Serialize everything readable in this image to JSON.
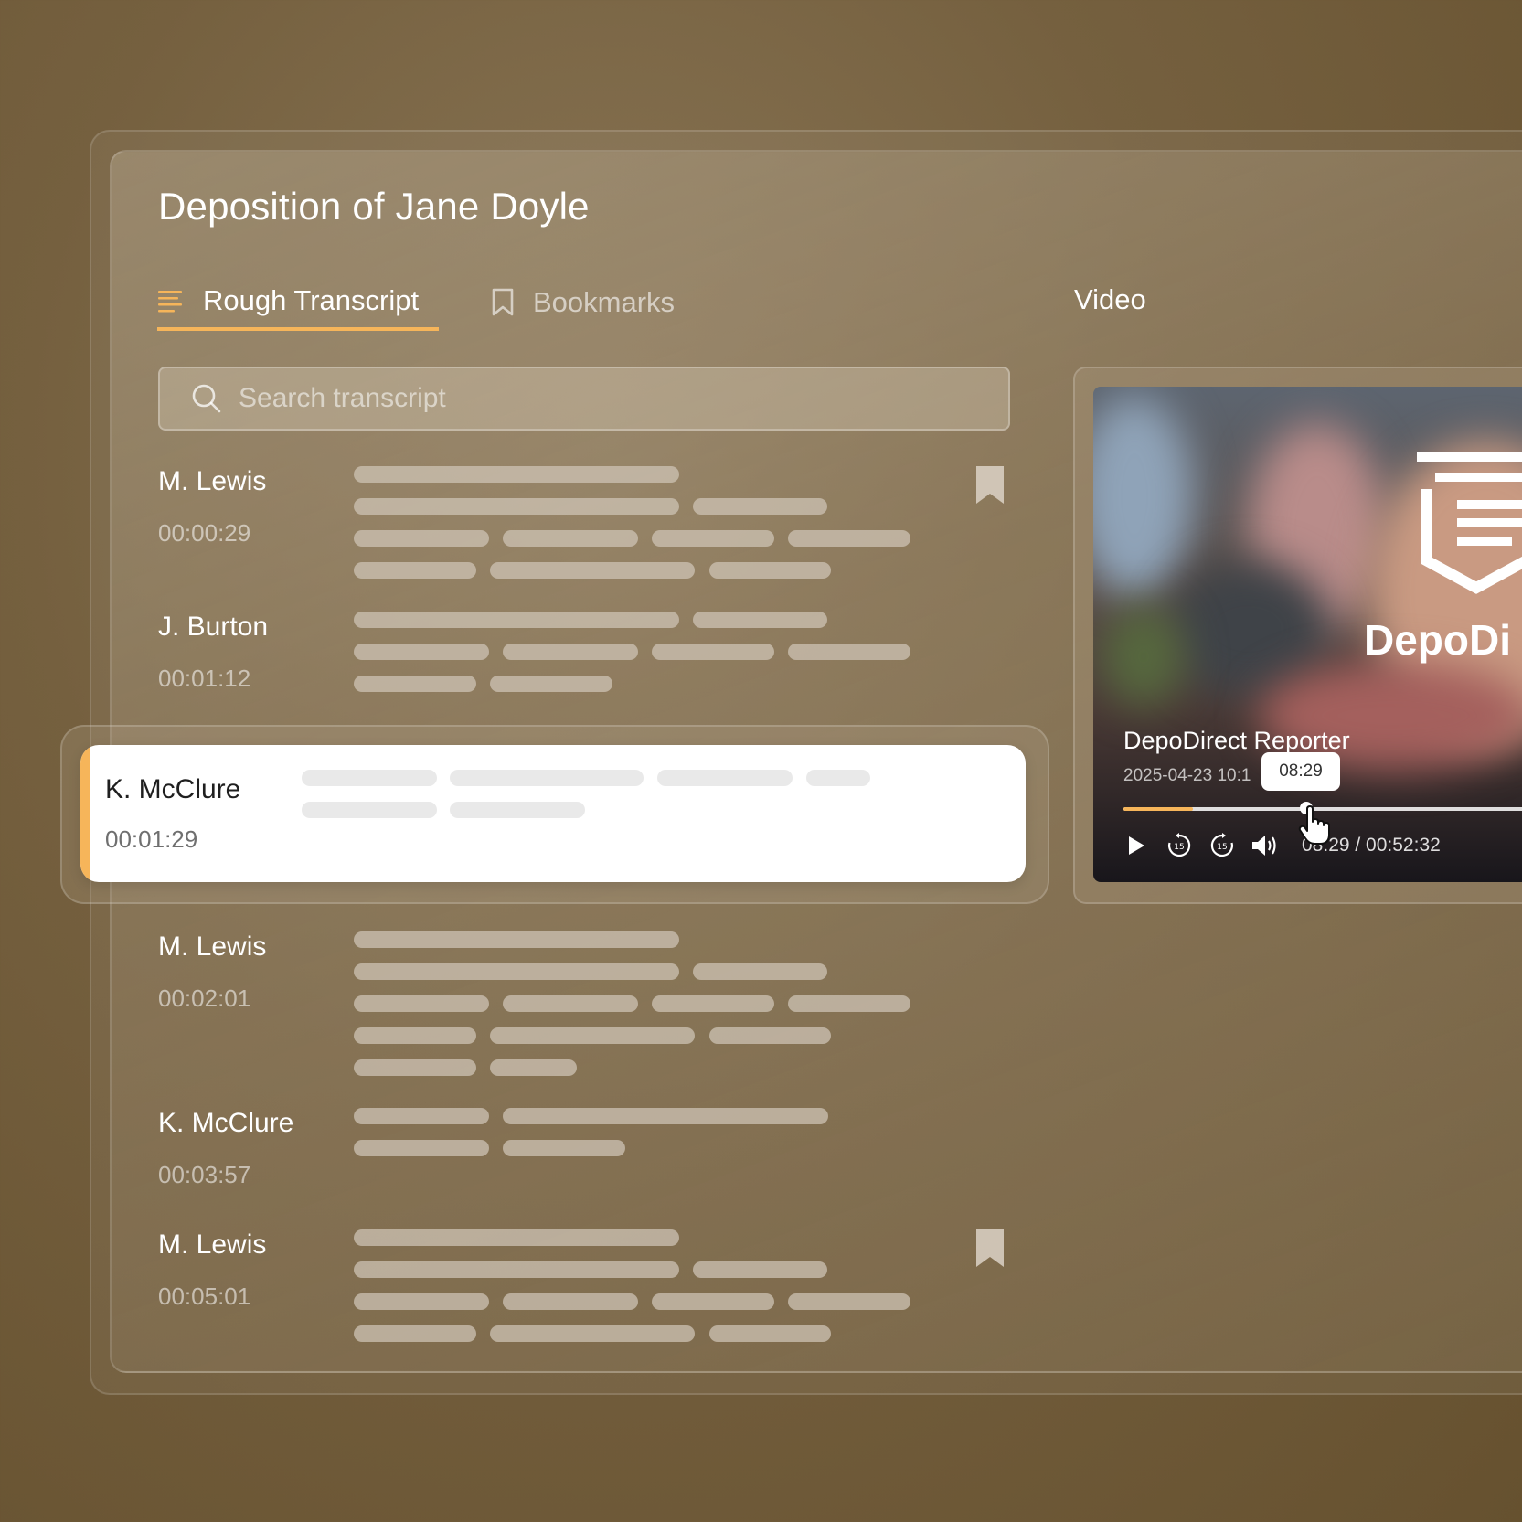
{
  "page": {
    "title": "Deposition of Jane Doyle"
  },
  "tabs": [
    {
      "label": "Rough Transcript",
      "active": true,
      "icon": "transcript-lines-icon"
    },
    {
      "label": "Bookmarks",
      "active": false,
      "icon": "bookmark-outline-icon"
    }
  ],
  "video_section": {
    "label": "Video"
  },
  "search": {
    "placeholder": "Search transcript",
    "value": ""
  },
  "transcript": [
    {
      "speaker": "M. Lewis",
      "time": "00:00:29",
      "bookmarked": true
    },
    {
      "speaker": "J. Burton",
      "time": "00:01:12",
      "bookmarked": false
    },
    {
      "speaker": "K. McClure",
      "time": "00:01:29",
      "bookmarked": false,
      "highlighted": true
    },
    {
      "speaker": "M. Lewis",
      "time": "00:02:01",
      "bookmarked": false
    },
    {
      "speaker": "K. McClure",
      "time": "00:03:57",
      "bookmarked": false
    },
    {
      "speaker": "M. Lewis",
      "time": "00:05:01",
      "bookmarked": true
    }
  ],
  "video": {
    "brand": "DepoDi",
    "reporter": "DepoDirect Reporter",
    "date": "2025-04-23 10:1",
    "tooltip_time": "08:29",
    "current_time": "08:29",
    "time_display": "08:29 / 00:52:32",
    "progress": 0.162,
    "controls": [
      "play-icon",
      "rewind-15-icon",
      "forward-15-icon",
      "volume-icon"
    ]
  },
  "colors": {
    "accent": "#f6b55a",
    "background": "#75603f",
    "highlight_card": "#ffffff"
  }
}
